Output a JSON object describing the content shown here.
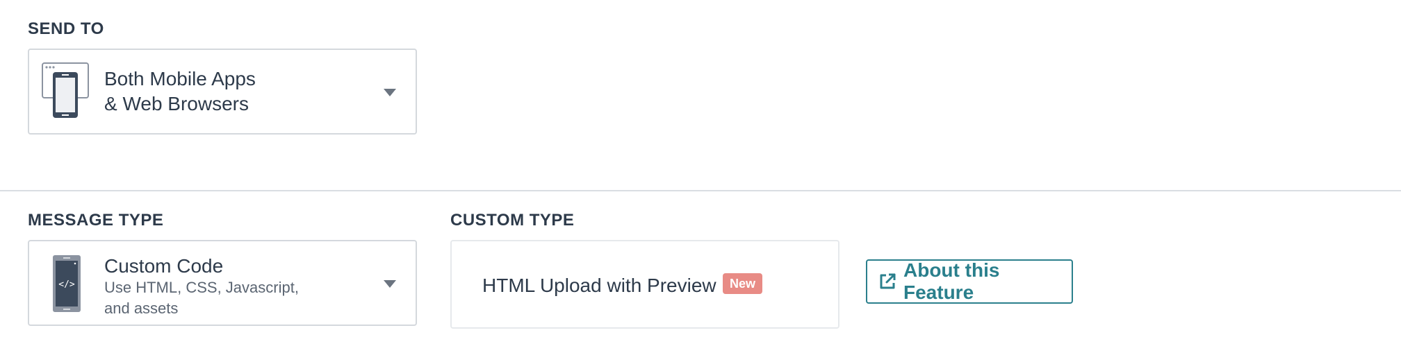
{
  "send_to": {
    "label": "SEND TO",
    "selected_line1": "Both Mobile Apps",
    "selected_line2": "& Web Browsers",
    "icon": "device-browser-icon"
  },
  "message_type": {
    "label": "MESSAGE TYPE",
    "title": "Custom Code",
    "desc_line1": "Use HTML, CSS, Javascript,",
    "desc_line2": "and assets",
    "icon": "code-phone-icon"
  },
  "custom_type": {
    "label": "CUSTOM TYPE",
    "option": "HTML Upload with Preview",
    "badge": "New"
  },
  "about_button": {
    "label": "About this Feature",
    "icon": "external-link-icon"
  },
  "colors": {
    "text": "#2d3a4a",
    "accent": "#2a7f8c",
    "badge": "#e88b85",
    "border": "#d4d8dd"
  }
}
